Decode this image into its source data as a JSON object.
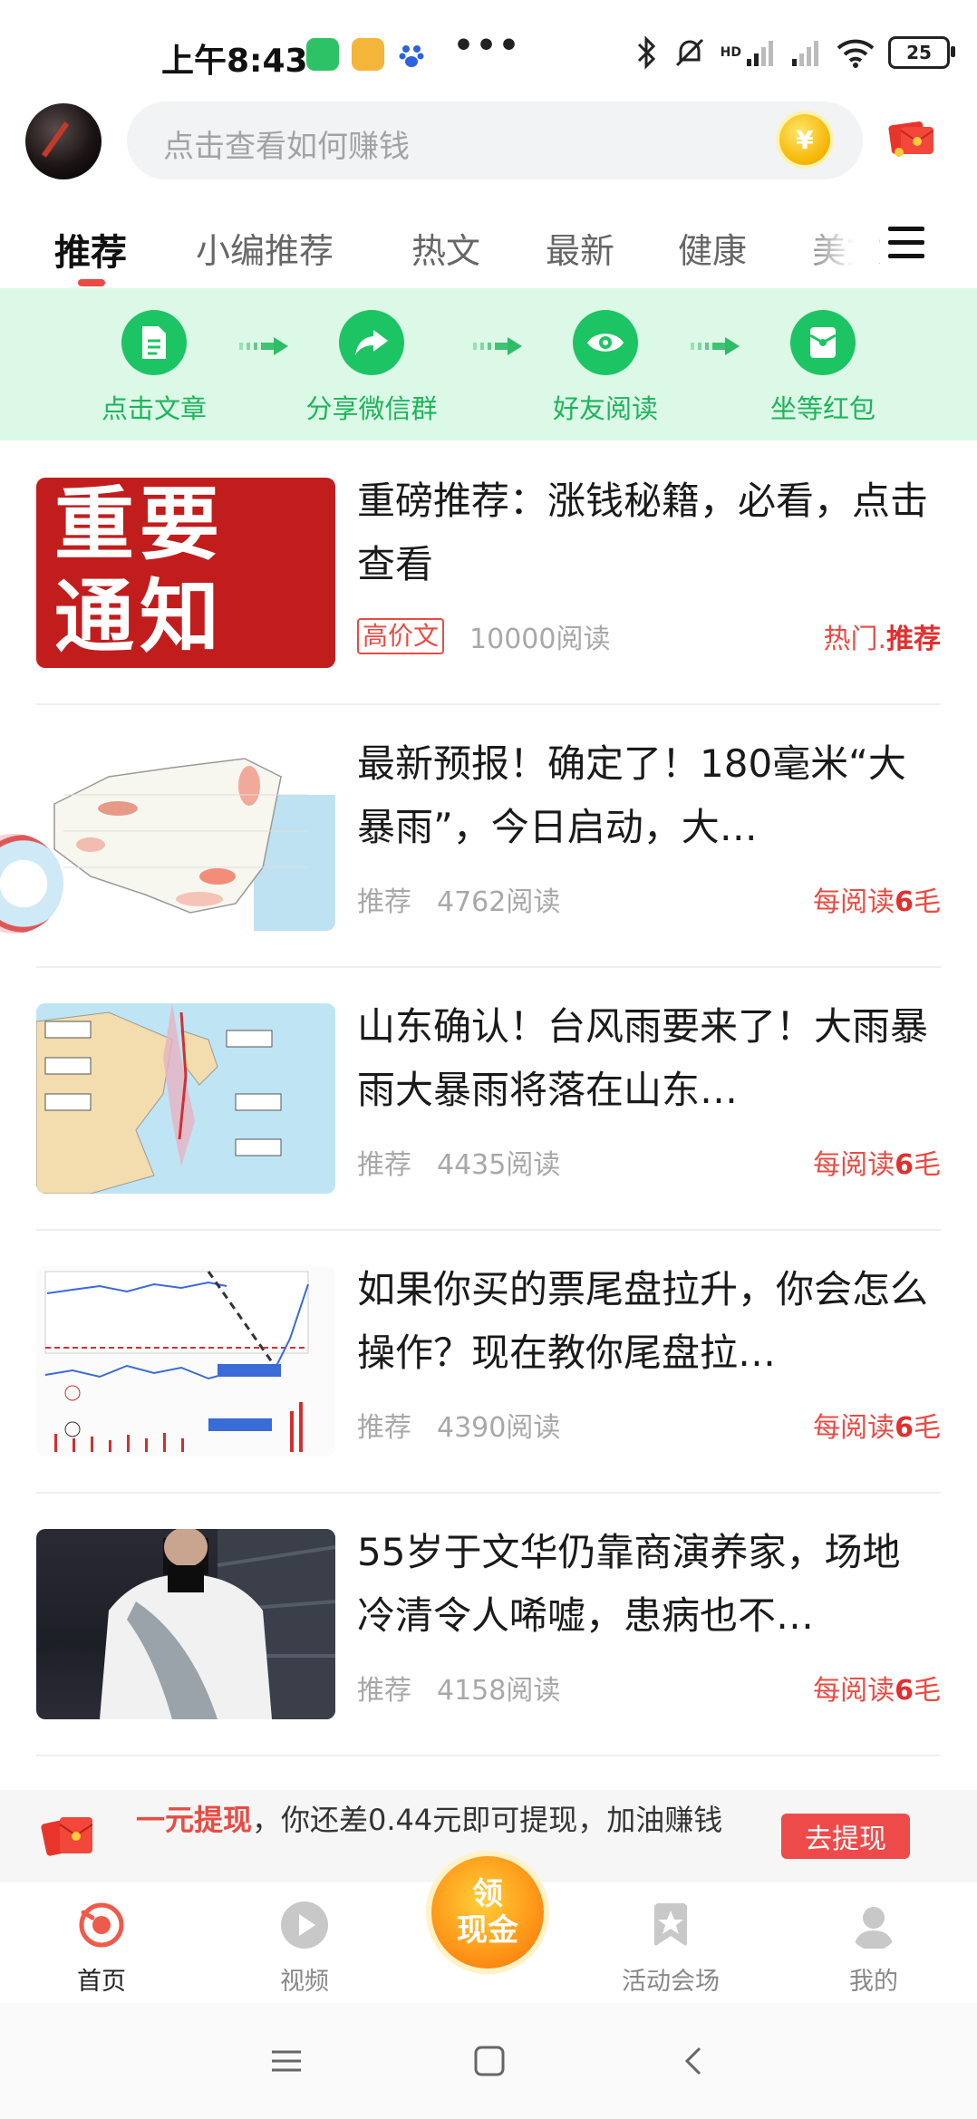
{
  "status": {
    "time": "上午8:43",
    "dots": "•••",
    "hd": "HD",
    "battery": "25"
  },
  "header": {
    "search_placeholder": "点击查看如何赚钱",
    "coin_symbol": "¥"
  },
  "tabs": [
    {
      "label": "推荐"
    },
    {
      "label": "小编推荐"
    },
    {
      "label": "热文"
    },
    {
      "label": "最新"
    },
    {
      "label": "健康"
    },
    {
      "label": "美文"
    }
  ],
  "steps": [
    {
      "label": "点击文章",
      "icon": "document-icon"
    },
    {
      "label": "分享微信群",
      "icon": "share-icon"
    },
    {
      "label": "好友阅读",
      "icon": "eye-icon"
    },
    {
      "label": "坐等红包",
      "icon": "red-packet-icon"
    }
  ],
  "articles": [
    {
      "title": "重磅推荐：涨钱秘籍，必看，点击查看",
      "tag": "高价文",
      "reads": "10000阅读",
      "reward_prefix": "热门.",
      "reward_strong": "推荐",
      "thumb_text_1": "重要",
      "thumb_text_2": "通知"
    },
    {
      "title": "最新预报！确定了！180毫米“大暴雨”，今日启动，大…",
      "tag": "推荐",
      "reads": "4762阅读",
      "reward_prefix": "每阅读",
      "reward_strong": "6",
      "reward_suffix": "毛"
    },
    {
      "title": "山东确认！台风雨要来了！大雨暴雨大暴雨将落在山东…",
      "tag": "推荐",
      "reads": "4435阅读",
      "reward_prefix": "每阅读",
      "reward_strong": "6",
      "reward_suffix": "毛"
    },
    {
      "title": "如果你买的票尾盘拉升，你会怎么操作？现在教你尾盘拉…",
      "tag": "推荐",
      "reads": "4390阅读",
      "reward_prefix": "每阅读",
      "reward_strong": "6",
      "reward_suffix": "毛"
    },
    {
      "title": "55岁于文华仍靠商演养家，场地冷清令人唏嘘，患病也不…",
      "tag": "推荐",
      "reads": "4158阅读",
      "reward_prefix": "每阅读",
      "reward_strong": "6",
      "reward_suffix": "毛"
    }
  ],
  "withdraw": {
    "highlight": "一元提现",
    "text": "，你还差0.44元即可提现，加油赚钱",
    "button": "去提现"
  },
  "bottom_nav": {
    "home": "首页",
    "video": "视频",
    "center_line1": "领",
    "center_line2": "现金",
    "activity": "活动会场",
    "mine": "我的"
  },
  "colors": {
    "accent_red": "#e94b43",
    "accent_green": "#1dc464",
    "banner_green": "#dcf8e6"
  }
}
